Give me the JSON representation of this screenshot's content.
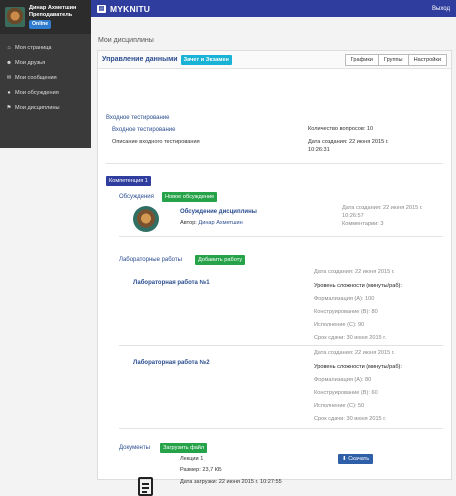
{
  "user": {
    "name": "Динар Ахметшин",
    "role": "Преподаватель",
    "status": "Online"
  },
  "nav": [
    {
      "icon": "home-icon",
      "glyph": "⌂",
      "label": "Моя страница"
    },
    {
      "icon": "users-icon",
      "glyph": "👥",
      "label": "Мои друзья"
    },
    {
      "icon": "envelope-icon",
      "glyph": "✉",
      "label": "Мои сообщения"
    },
    {
      "icon": "comments-icon",
      "glyph": "●",
      "label": "Мои обсуждения"
    },
    {
      "icon": "flag-icon",
      "glyph": "⚑",
      "label": "Мои дисциплины"
    }
  ],
  "topbar": {
    "brand": "MYKNITU",
    "logout": "Выход"
  },
  "page_title": "Мои дисциплины",
  "panel": {
    "title": "Управление данными",
    "tag": "Зачет и Экзамен",
    "buttons": [
      "Графики",
      "Группы",
      "Настройки"
    ]
  },
  "entry_test": {
    "section": "Входное тестирование",
    "title": "Входное тестирование",
    "desc": "Описание входного тестирования",
    "questions": "Количество вопросов: 10",
    "created": "Дата создания: 22 июня 2015 г. 10:26:31"
  },
  "competence": "Компетенция 1",
  "discussions": {
    "label": "Обсуждения",
    "new_button": "Новое обсуждение",
    "item": {
      "title": "Обсуждение дисциплины",
      "author_prefix": "Автор:",
      "author": "Динар Ахметшин",
      "created": "Дата создания: 22 июня 2015 г. 10:26:57",
      "comments": "Комментарии: 3"
    }
  },
  "labs": {
    "label": "Лабораторные работы",
    "add_button": "Добавить работу",
    "items": [
      {
        "title": "Лабораторная работа №1",
        "created": "Дата создания: 22 июня 2015 г.",
        "level_heading": "Уровень сложности (минуты/раб):",
        "formalization": "Формализация (A): 100",
        "construction": "Конструирование (B): 80",
        "execution": "Исполнение (C): 90",
        "deadline": "Срок сдачи: 30 июня 2015 г."
      },
      {
        "title": "Лабораторная работа №2",
        "created": "Дата создания: 22 июня 2015 г.",
        "level_heading": "Уровень сложности (минуты/раб):",
        "formalization": "Формализация (A): 80",
        "construction": "Конструирование (B): 60",
        "execution": "Исполнение (C): 50",
        "deadline": "Срок сдачи: 30 июня 2015 г."
      }
    ]
  },
  "documents": {
    "label": "Документы",
    "upload_button": "Загрузить файл",
    "file": {
      "name": "Лекции 1",
      "size": "Размер: 23,7 КБ",
      "uploaded": "Дата загрузки: 22 июня 2015 г. 10:27:55",
      "download": "Скачать"
    }
  }
}
